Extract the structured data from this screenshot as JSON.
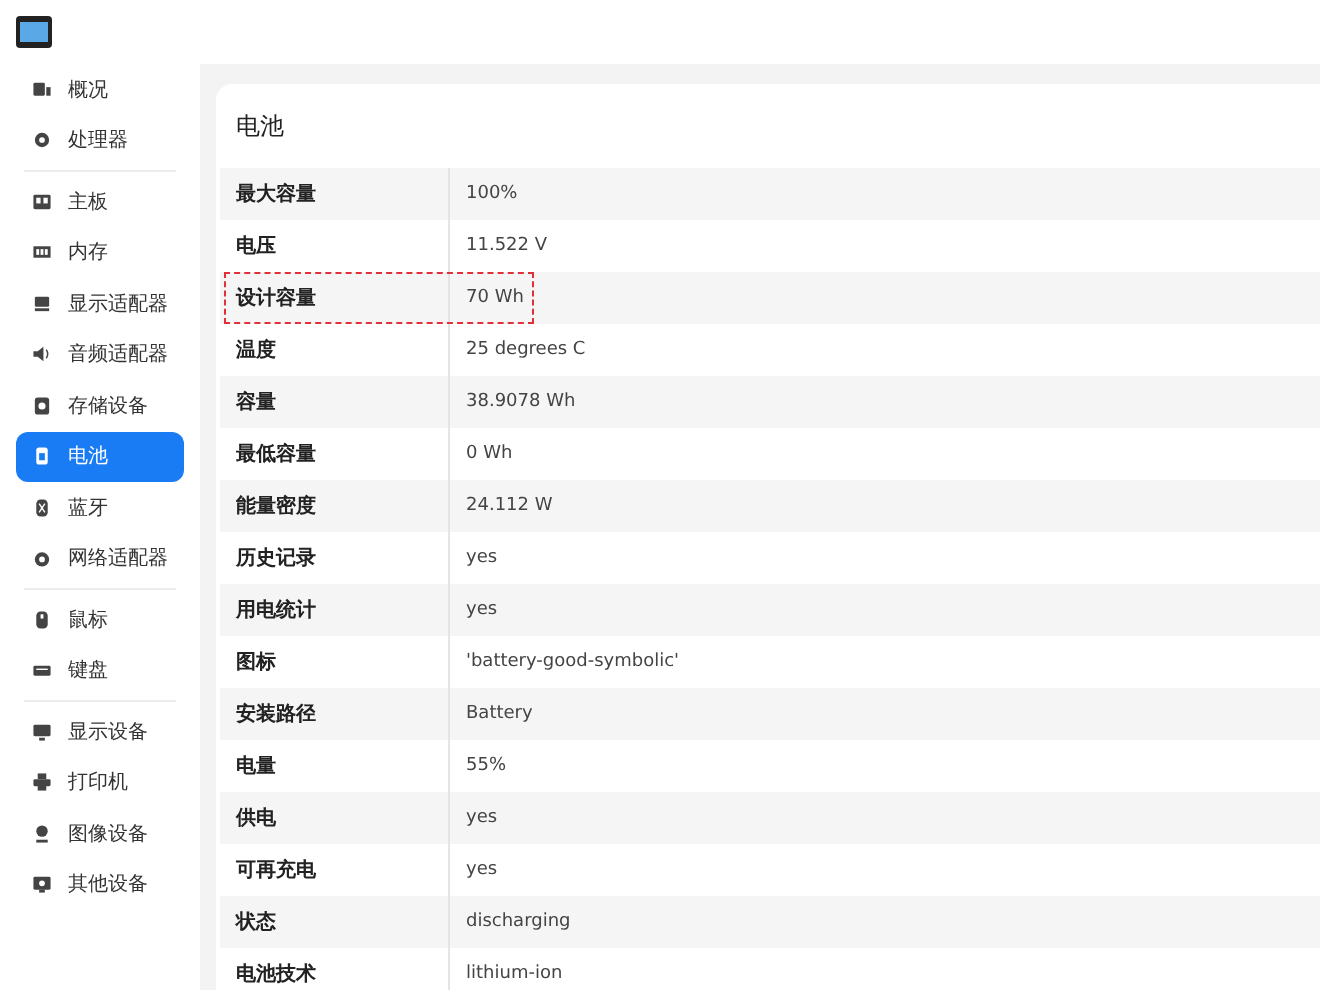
{
  "sidebar": {
    "groups": [
      {
        "items": [
          {
            "label": "概况",
            "selected": false
          },
          {
            "label": "处理器",
            "selected": false
          }
        ]
      },
      {
        "items": [
          {
            "label": "主板",
            "selected": false
          },
          {
            "label": "内存",
            "selected": false
          },
          {
            "label": "显示适配器",
            "selected": false
          },
          {
            "label": "音频适配器",
            "selected": false
          },
          {
            "label": "存储设备",
            "selected": false
          },
          {
            "label": "电池",
            "selected": true
          },
          {
            "label": "蓝牙",
            "selected": false
          },
          {
            "label": "网络适配器",
            "selected": false
          }
        ]
      },
      {
        "items": [
          {
            "label": "鼠标",
            "selected": false
          },
          {
            "label": "键盘",
            "selected": false
          }
        ]
      },
      {
        "items": [
          {
            "label": "显示设备",
            "selected": false
          },
          {
            "label": "打印机",
            "selected": false
          },
          {
            "label": "图像设备",
            "selected": false
          },
          {
            "label": "其他设备",
            "selected": false
          }
        ]
      }
    ]
  },
  "panel": {
    "title": "电池",
    "rows": [
      {
        "label": "最大容量",
        "value": "100%",
        "highlighted": false
      },
      {
        "label": "电压",
        "value": "11.522 V",
        "highlighted": false
      },
      {
        "label": "设计容量",
        "value": "70 Wh",
        "highlighted": true
      },
      {
        "label": "温度",
        "value": "25 degrees C",
        "highlighted": false
      },
      {
        "label": "容量",
        "value": "38.9078 Wh",
        "highlighted": false
      },
      {
        "label": "最低容量",
        "value": "0 Wh",
        "highlighted": false
      },
      {
        "label": "能量密度",
        "value": "24.112 W",
        "highlighted": false
      },
      {
        "label": "历史记录",
        "value": "yes",
        "highlighted": false
      },
      {
        "label": "用电统计",
        "value": "yes",
        "highlighted": false
      },
      {
        "label": "图标",
        "value": "'battery-good-symbolic'",
        "highlighted": false
      },
      {
        "label": "安装路径",
        "value": "Battery",
        "highlighted": false
      },
      {
        "label": "电量",
        "value": "55%",
        "highlighted": false
      },
      {
        "label": "供电",
        "value": "yes",
        "highlighted": false
      },
      {
        "label": "可再充电",
        "value": "yes",
        "highlighted": false
      },
      {
        "label": "状态",
        "value": "discharging",
        "highlighted": false
      },
      {
        "label": "电池技术",
        "value": "lithium-ion",
        "highlighted": false
      }
    ]
  }
}
